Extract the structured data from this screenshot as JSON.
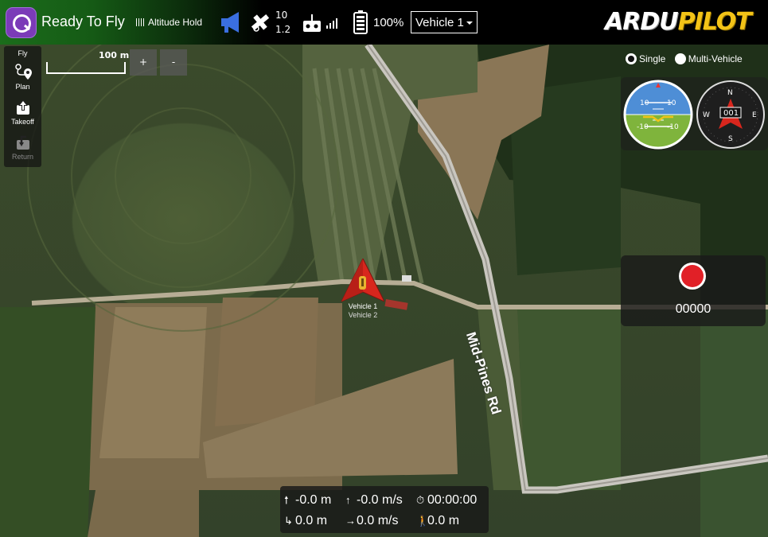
{
  "toolbar": {
    "status": "Ready To Fly",
    "flight_mode": "Altitude Hold",
    "gps": {
      "satellites": "10",
      "hdop": "1.2"
    },
    "battery": "100%",
    "vehicle_select": "Vehicle 1",
    "brand_left": "ARDU",
    "brand_right": "PILOT"
  },
  "toolstrip": {
    "fly": "Fly",
    "plan": "Plan",
    "takeoff": "Takeoff",
    "return": "Return"
  },
  "map": {
    "scale_label": "100 m",
    "zoom_in": "+",
    "zoom_out": "-",
    "road_label": "Mid-Pines Rd"
  },
  "vehicles": {
    "primary": "Vehicle 1",
    "secondary": "Vehicle 2"
  },
  "view_mode": {
    "single": "Single",
    "multi": "Multi-Vehicle",
    "selected": "Single"
  },
  "attitude": {
    "pitch_up": "10",
    "pitch_down": "-10"
  },
  "compass": {
    "heading": "001",
    "n": "N",
    "e": "E",
    "s": "S",
    "w": "W"
  },
  "recording": {
    "time": "00000"
  },
  "telemetry": {
    "altitude": "-0.0 m",
    "vertical_speed": "-0.0 m/s",
    "flight_time": "00:00:00",
    "distance": "0.0 m",
    "ground_speed": "0.0 m/s",
    "home_distance": "0.0 m"
  },
  "colors": {
    "toolbar_green": "#1b6d1b",
    "logo_purple": "#7b3bb8",
    "brand_gold": "#f3c317",
    "record_red": "#e12027",
    "vehicle_red": "#d8261d"
  }
}
